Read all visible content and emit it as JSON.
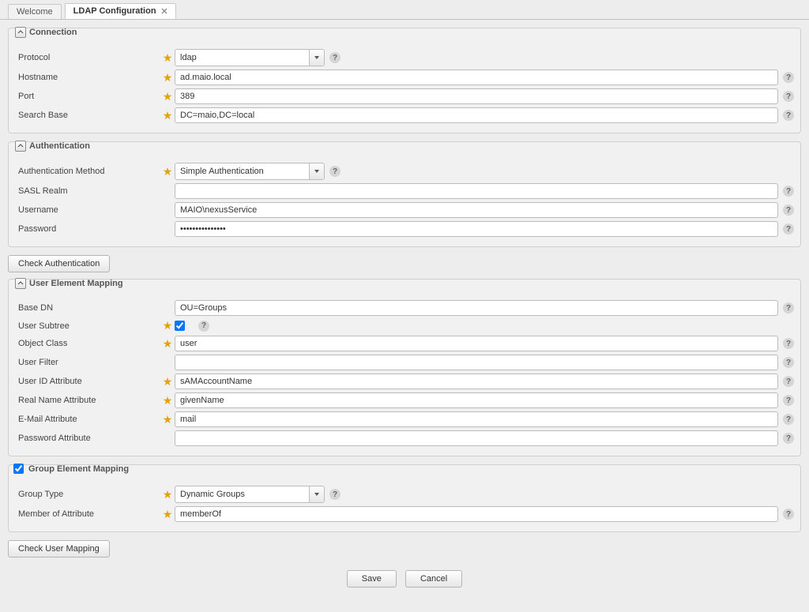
{
  "tabs": {
    "welcome": "Welcome",
    "ldap": "LDAP Configuration"
  },
  "connection": {
    "legend": "Connection",
    "protocol_label": "Protocol",
    "protocol_value": "ldap",
    "hostname_label": "Hostname",
    "hostname_value": "ad.maio.local",
    "port_label": "Port",
    "port_value": "389",
    "searchbase_label": "Search Base",
    "searchbase_value": "DC=maio,DC=local"
  },
  "auth": {
    "legend": "Authentication",
    "method_label": "Authentication Method",
    "method_value": "Simple Authentication",
    "sasl_label": "SASL Realm",
    "sasl_value": "",
    "username_label": "Username",
    "username_value": "MAIO\\nexusService",
    "password_label": "Password",
    "password_value": "•••••••••••••••"
  },
  "check_auth_label": "Check Authentication",
  "user_mapping": {
    "legend": "User Element Mapping",
    "basedn_label": "Base DN",
    "basedn_value": "OU=Groups",
    "subtree_label": "User Subtree",
    "object_class_label": "Object Class",
    "object_class_value": "user",
    "filter_label": "User Filter",
    "filter_value": "",
    "userid_label": "User ID Attribute",
    "userid_value": "sAMAccountName",
    "realname_label": "Real Name Attribute",
    "realname_value": "givenName",
    "email_label": "E-Mail Attribute",
    "email_value": "mail",
    "pwdattr_label": "Password Attribute",
    "pwdattr_value": ""
  },
  "group_mapping": {
    "legend": "Group Element Mapping",
    "grouptype_label": "Group Type",
    "grouptype_value": "Dynamic Groups",
    "memberof_label": "Member of Attribute",
    "memberof_value": "memberOf"
  },
  "check_user_label": "Check User Mapping",
  "footer": {
    "save": "Save",
    "cancel": "Cancel"
  }
}
